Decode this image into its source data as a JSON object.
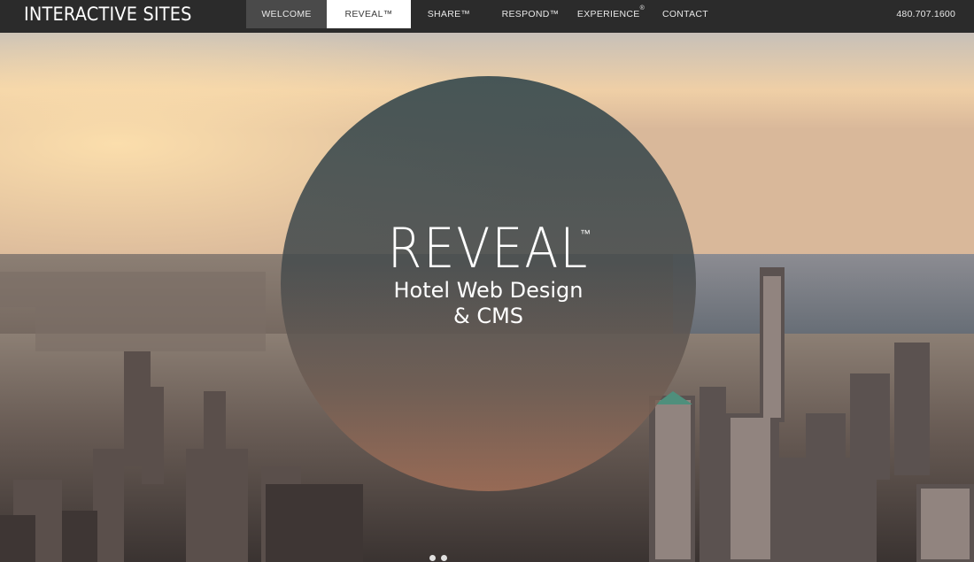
{
  "header": {
    "logo": "INTERACTIVE SITES",
    "phone": "480.707.1600"
  },
  "nav": {
    "welcome": "WELCOME",
    "reveal": "REVEAL™",
    "share": "SHARE™",
    "respond": "RESPOND™",
    "experience": "EXPERIENCE",
    "experience_mark": "®",
    "contact": "CONTACT"
  },
  "hero": {
    "title": "REVEAL",
    "trademark": "™",
    "subtitle_line1": "Hotel Web Design",
    "subtitle_line2": "& CMS",
    "background_icon": "city-skyline-image"
  },
  "colors": {
    "topbar": "#2b2b2b",
    "active_nav": "#ffffff",
    "hover_nav": "#4a4a4a",
    "circle": "#3a4c50"
  }
}
